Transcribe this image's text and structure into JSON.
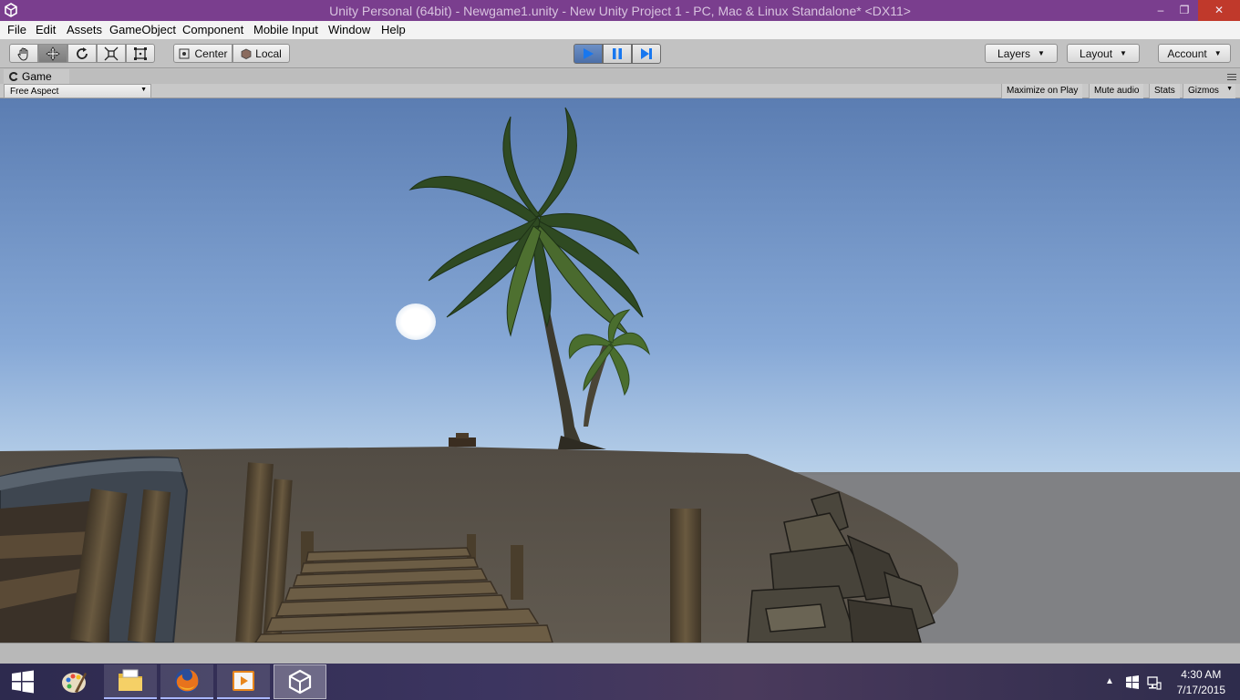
{
  "window": {
    "title": "Unity Personal (64bit) - Newgame1.unity - New Unity Project 1 - PC, Mac & Linux Standalone* <DX11>",
    "minimize": "–",
    "restore": "❐",
    "close": "✕"
  },
  "menu": {
    "items": [
      "File",
      "Edit",
      "Assets",
      "GameObject",
      "Component",
      "Mobile Input",
      "Window",
      "Help"
    ]
  },
  "toolbar": {
    "tools": [
      "hand-tool",
      "move-tool",
      "rotate-tool",
      "scale-tool",
      "rect-tool"
    ],
    "active_tool": "move-tool",
    "pivot": "Center",
    "space": "Local",
    "play_state": "playing",
    "layers": "Layers",
    "layout": "Layout",
    "account": "Account"
  },
  "game_view": {
    "tab_label": "Game",
    "aspect": "Free Aspect",
    "options": [
      "Maximize on Play",
      "Mute audio",
      "Stats",
      "Gizmos"
    ]
  },
  "taskbar": {
    "apps": [
      "start-button",
      "paint-icon",
      "file-explorer-icon",
      "firefox-icon",
      "media-player-icon",
      "unity-icon"
    ],
    "active_app": "unity-icon",
    "time": "4:30 AM",
    "date": "7/17/2015"
  },
  "colors": {
    "titlebar": "#7a3e8e",
    "sky_top": "#6080b4",
    "sky_horizon": "#cfe3f2",
    "sand": "#5c564e",
    "play_active": "#4c6fa8"
  }
}
